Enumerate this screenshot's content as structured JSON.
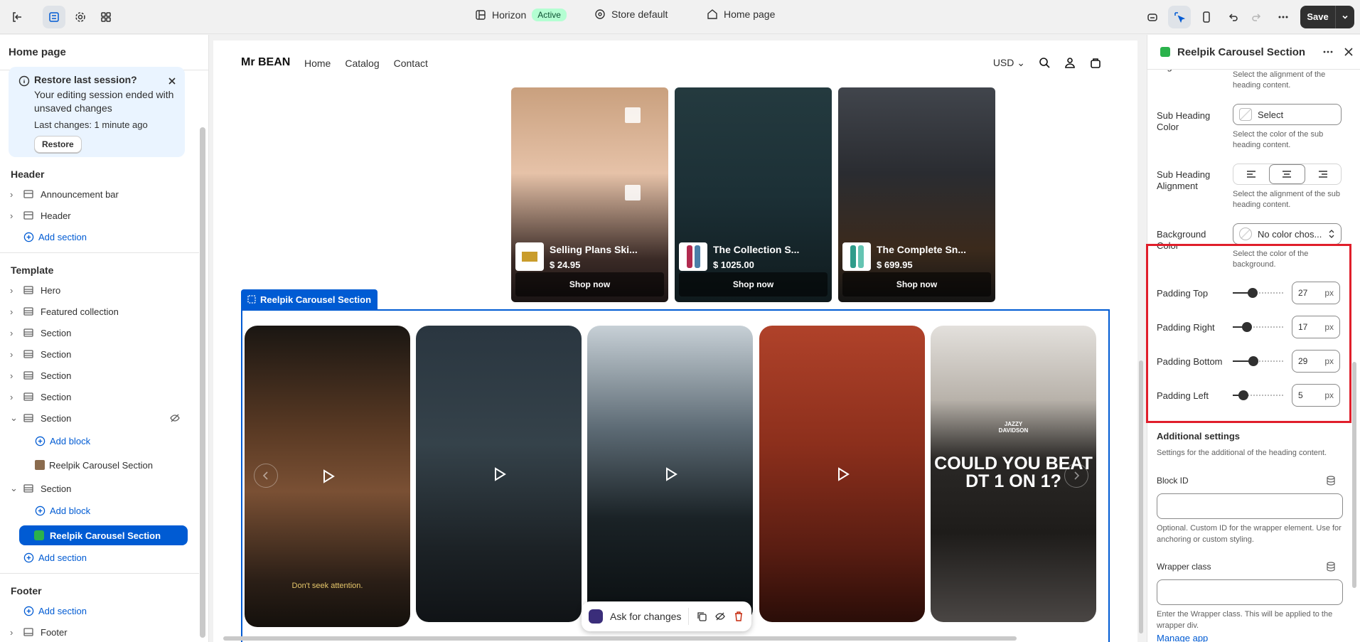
{
  "topbar": {
    "theme_name": "Horizon",
    "theme_status": "Active",
    "store_label": "Store default",
    "page_label": "Home page",
    "save_label": "Save"
  },
  "sidebar": {
    "title": "Home page",
    "restore": {
      "title": "Restore last session?",
      "body": "Your editing session ended with unsaved changes",
      "last_changes": "Last changes: 1 minute ago",
      "button": "Restore"
    },
    "header_group": "Header",
    "header_items": [
      "Announcement bar",
      "Header"
    ],
    "add_section": "Add section",
    "template_group": "Template",
    "template_items": [
      "Hero",
      "Featured collection",
      "Section",
      "Section",
      "Section",
      "Section",
      "Section"
    ],
    "add_block": "Add block",
    "nested_block": "Reelpik Carousel Section",
    "section_last": "Section",
    "selected_block": "Reelpik Carousel Section",
    "footer_group": "Footer",
    "footer_item": "Footer"
  },
  "preview": {
    "brand": "Mr BEAN",
    "nav": [
      "Home",
      "Catalog",
      "Contact"
    ],
    "currency": "USD",
    "products": [
      {
        "name": "Selling Plans Ski...",
        "price": "$ 24.95",
        "cta": "Shop now"
      },
      {
        "name": "The Collection S...",
        "price": "$ 1025.00",
        "cta": "Shop now"
      },
      {
        "name": "The Complete Sn...",
        "price": "$ 699.95",
        "cta": "Shop now"
      }
    ],
    "selection_label": "Reelpik Carousel Section",
    "reel_caption": "Don't seek attention.",
    "reel_promo_line1": "JAZZY",
    "reel_promo_line2": "DAVIDSON",
    "reel_promo_line3": "COULD YOU BEAT",
    "reel_promo_line4": "DT 1 ON 1?",
    "ask_label": "Ask for changes"
  },
  "panel": {
    "title": "Reelpik Carousel Section",
    "alignment_label": "Alignment",
    "alignment_help": "Select the alignment of the heading content.",
    "subheading_color_label": "Sub Heading Color",
    "subheading_color_value": "Select",
    "subheading_color_help": "Select the color of the sub heading content.",
    "subheading_align_label": "Sub Heading Alignment",
    "subheading_align_help": "Select the alignment of the sub heading content.",
    "bg_color_label": "Background Color",
    "bg_color_value": "No color chos...",
    "bg_color_help": "Select the color of the background.",
    "padding": [
      {
        "label": "Padding Top",
        "value": "27",
        "unit": "px",
        "fraction": 0.27
      },
      {
        "label": "Padding Right",
        "value": "17",
        "unit": "px",
        "fraction": 0.17
      },
      {
        "label": "Padding Bottom",
        "value": "29",
        "unit": "px",
        "fraction": 0.29
      },
      {
        "label": "Padding Left",
        "value": "5",
        "unit": "px",
        "fraction": 0.1
      }
    ],
    "additional_title": "Additional settings",
    "additional_help": "Settings for the additional of the heading content.",
    "block_id_label": "Block ID",
    "block_id_help": "Optional. Custom ID for the wrapper element. Use for anchoring or custom styling.",
    "wrapper_label": "Wrapper class",
    "wrapper_help": "Enter the Wrapper class. This will be applied to the wrapper div.",
    "manage_app": "Manage app"
  },
  "colors": {
    "accent": "#005bd3",
    "highlight_box": "#e01e2b",
    "active_badge": "#b4fed2"
  }
}
